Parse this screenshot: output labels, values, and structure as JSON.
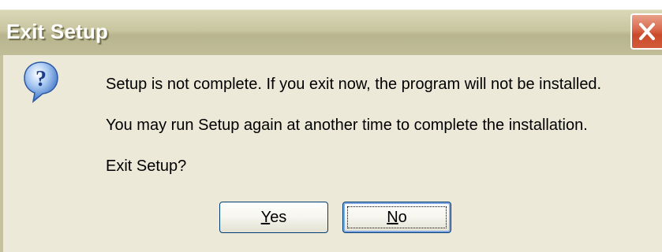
{
  "dialog": {
    "title": "Exit Setup",
    "icon": "question-icon",
    "messages": [
      "Setup is not complete. If you exit now, the program will not be installed.",
      "You may run Setup again at another time to complete the installation.",
      "Exit Setup?"
    ],
    "buttons": {
      "yes": {
        "mnemonic": "Y",
        "rest": "es"
      },
      "no": {
        "mnemonic": "N",
        "rest": "o"
      }
    },
    "default_button": "No"
  },
  "colors": {
    "titlebar": "#c8c5a0",
    "client": "#ece9d8",
    "close": "#d8684a",
    "button_border": "#003c74"
  }
}
